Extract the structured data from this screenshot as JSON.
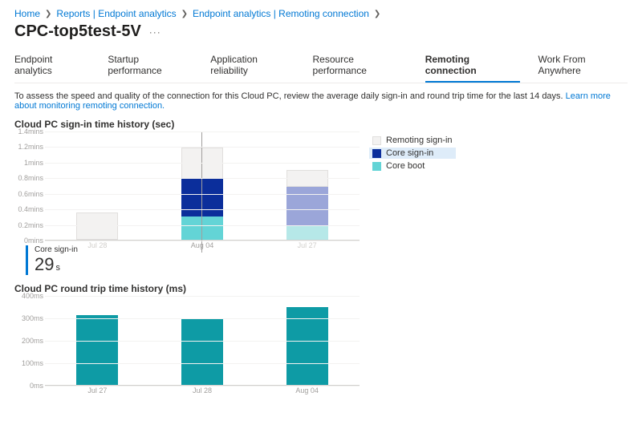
{
  "breadcrumb": [
    {
      "label": "Home"
    },
    {
      "label": "Reports | Endpoint analytics"
    },
    {
      "label": "Endpoint analytics | Remoting connection"
    }
  ],
  "page_title": "CPC-top5test-5V",
  "tabs": [
    {
      "label": "Endpoint analytics"
    },
    {
      "label": "Startup performance"
    },
    {
      "label": "Application reliability"
    },
    {
      "label": "Resource performance"
    },
    {
      "label": "Remoting connection",
      "active": true
    },
    {
      "label": "Work From Anywhere"
    }
  ],
  "description": "To assess the speed and quality of the connection for this Cloud PC, review the average daily sign-in and round trip time for the last 14 days.",
  "description_link": "Learn more about monitoring remoting connection.",
  "chart1": {
    "title": "Cloud PC sign-in time history (sec)",
    "legend": [
      {
        "name": "Remoting sign-in",
        "color": "#f3f2f1"
      },
      {
        "name": "Core sign-in",
        "color": "#0b2e9b"
      },
      {
        "name": "Core boot",
        "color": "#63d4d6"
      }
    ],
    "highlight_legend_index": 1
  },
  "callout": {
    "label": "Core sign-in",
    "value": "29",
    "unit": "s"
  },
  "chart2": {
    "title": "Cloud PC round trip time history (ms)"
  },
  "colors": {
    "remoting": "#f3f2f1",
    "remoting_border": "#e1dfdd",
    "core_signin": "#0b2e9b",
    "core_boot": "#63d4d6",
    "faded_signin": "#9ba6d9",
    "faded_boot": "#b6e8e8",
    "teal": "#0e9ba5",
    "faded_xlabel": "#d0cecb"
  },
  "chart_data": [
    {
      "type": "bar",
      "title": "Cloud PC sign-in time history (sec)",
      "stacked": true,
      "ylabel": "minutes",
      "ylim": [
        0,
        1.4
      ],
      "yticks": [
        "0mins",
        "0.2mins",
        "0.4mins",
        "0.6mins",
        "0.8mins",
        "1mins",
        "1.2mins",
        "1.4mins"
      ],
      "categories": [
        "Jul 28",
        "Aug 04",
        "Jul 27"
      ],
      "series": [
        {
          "name": "Core boot",
          "values": [
            0.0,
            0.3,
            0.18
          ]
        },
        {
          "name": "Core sign-in",
          "values": [
            0.0,
            0.48,
            0.5
          ]
        },
        {
          "name": "Remoting sign-in",
          "values": [
            0.35,
            0.4,
            0.22
          ]
        }
      ],
      "selected_category_index": 1,
      "faded_category_indices": [
        0,
        2
      ]
    },
    {
      "type": "bar",
      "title": "Cloud PC round trip time history (ms)",
      "ylabel": "ms",
      "ylim": [
        0,
        400
      ],
      "yticks": [
        "0ms",
        "100ms",
        "200ms",
        "300ms",
        "400ms"
      ],
      "categories": [
        "Jul 27",
        "Jul 28",
        "Aug 04"
      ],
      "series": [
        {
          "name": "Round trip time",
          "values": [
            310,
            295,
            345
          ]
        }
      ]
    }
  ]
}
